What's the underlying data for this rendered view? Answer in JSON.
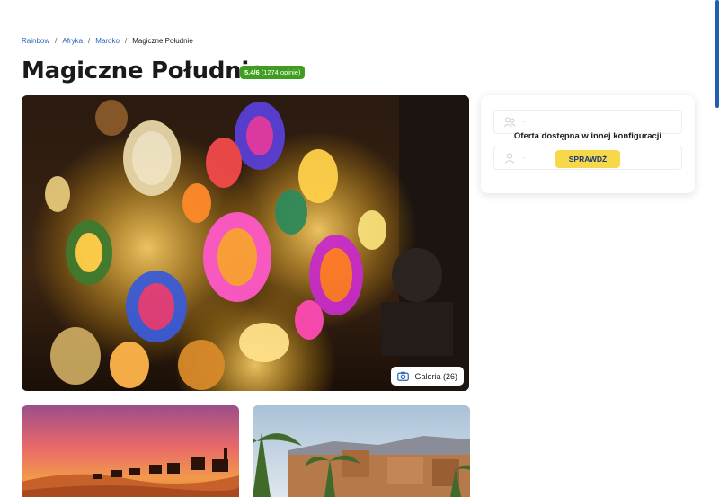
{
  "breadcrumb": {
    "items": [
      "Rainbow",
      "Afryka",
      "Maroko"
    ],
    "current": "Magiczne Południe",
    "separator": "/"
  },
  "page": {
    "title": "Magiczne Południe",
    "rating_score": "5.4/6",
    "rating_count": "(1274 opinie)"
  },
  "gallery": {
    "label": "Galeria (26)",
    "icon": "camera-icon"
  },
  "offer_card": {
    "message": "Oferta dostępna w innej konfiguracji",
    "button_label": "SPRAWDŹ",
    "row1_value": "-",
    "row2_value": "-",
    "row1_icon": "people-icon",
    "row2_icon": "person-icon"
  },
  "colors": {
    "link": "#2a66b8",
    "rating_bg": "#3f9e1f",
    "button_bg": "#f7d84a",
    "button_text": "#1a3a7a",
    "scrollbar": "#1f5fae"
  }
}
